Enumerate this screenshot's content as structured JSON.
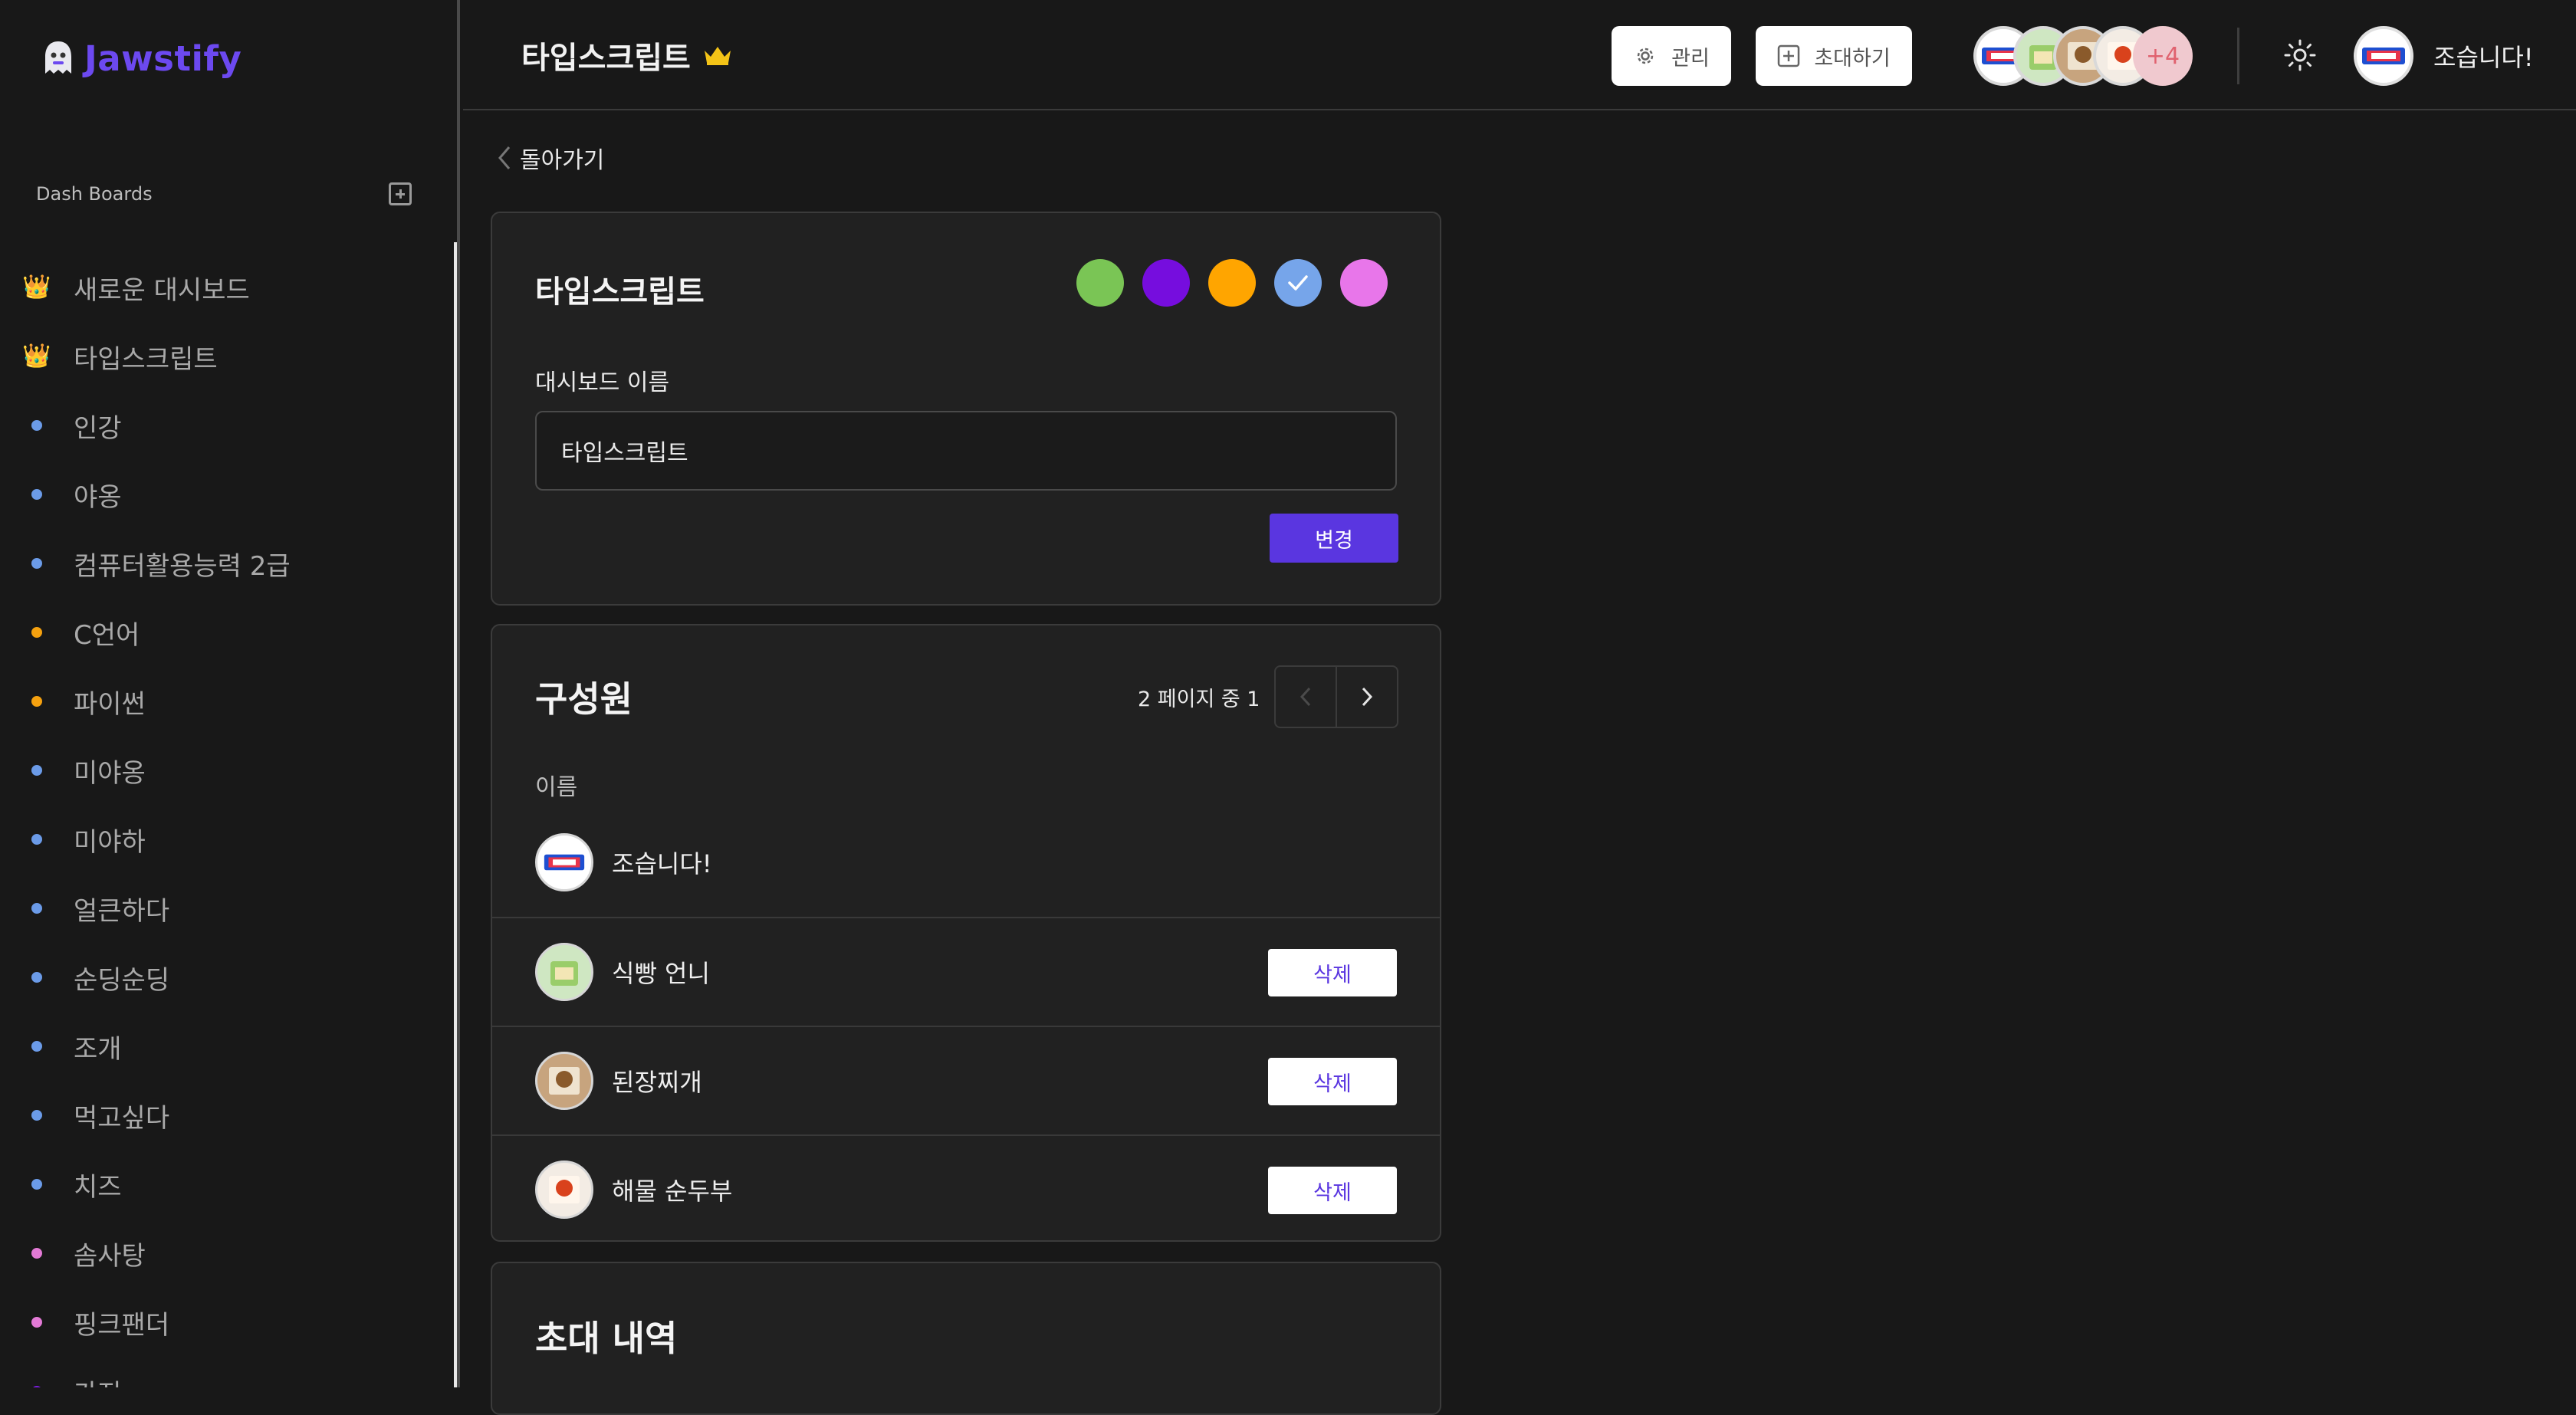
{
  "app": {
    "name": "Jawstify",
    "brand_color": "#6c49f0"
  },
  "sidebar": {
    "section_label": "Dash Boards",
    "items": [
      {
        "label": "새로운 대시보드",
        "marker": "emoji",
        "emoji": "👑",
        "color": "#f2c230"
      },
      {
        "label": "타입스크립트",
        "marker": "emoji",
        "emoji": "👑",
        "color": "#f2c230"
      },
      {
        "label": "인강",
        "marker": "dot",
        "color": "#6b9be8"
      },
      {
        "label": "야옹",
        "marker": "dot",
        "color": "#6b9be8"
      },
      {
        "label": "컴퓨터활용능력 2급",
        "marker": "dot",
        "color": "#6b9be8"
      },
      {
        "label": "C언어",
        "marker": "dot",
        "color": "#f5a10f"
      },
      {
        "label": "파이썬",
        "marker": "dot",
        "color": "#f5a10f"
      },
      {
        "label": "미야옹",
        "marker": "dot",
        "color": "#6b9be8"
      },
      {
        "label": "미야하",
        "marker": "dot",
        "color": "#6b9be8"
      },
      {
        "label": "얼큰하다",
        "marker": "dot",
        "color": "#6b9be8"
      },
      {
        "label": "순딩순딩",
        "marker": "dot",
        "color": "#6b9be8"
      },
      {
        "label": "조개",
        "marker": "dot",
        "color": "#6b9be8"
      },
      {
        "label": "먹고싶다",
        "marker": "dot",
        "color": "#6b9be8"
      },
      {
        "label": "치즈",
        "marker": "dot",
        "color": "#6b9be8"
      },
      {
        "label": "솜사탕",
        "marker": "dot",
        "color": "#e37ad6"
      },
      {
        "label": "핑크팬더",
        "marker": "dot",
        "color": "#e37ad6"
      },
      {
        "label": "가지",
        "marker": "dot",
        "color": "#7c1ce0"
      }
    ]
  },
  "topbar": {
    "board_title": "타입스크립트",
    "manage_label": "관리",
    "invite_label": "초대하기",
    "more_members": "+4",
    "user_name": "조습니다!"
  },
  "main": {
    "back_label": "돌아가기",
    "settings_card": {
      "title": "타입스크립트",
      "colors": [
        "#7ac555",
        "#760dde",
        "#ffa500",
        "#76a5ea",
        "#e876ea"
      ],
      "selected_color_index": 3,
      "name_label": "대시보드 이름",
      "name_value": "타입스크립트",
      "change_label": "변경"
    },
    "members_card": {
      "title": "구성원",
      "pagination": "2 페이지 중 1",
      "column_name": "이름",
      "delete_label": "삭제",
      "members": [
        {
          "name": "조습니다!",
          "deletable": false
        },
        {
          "name": "식빵 언니",
          "deletable": true
        },
        {
          "name": "된장찌개",
          "deletable": true
        },
        {
          "name": "해물 순두부",
          "deletable": true
        }
      ]
    },
    "invites_card": {
      "title": "초대 내역"
    }
  }
}
